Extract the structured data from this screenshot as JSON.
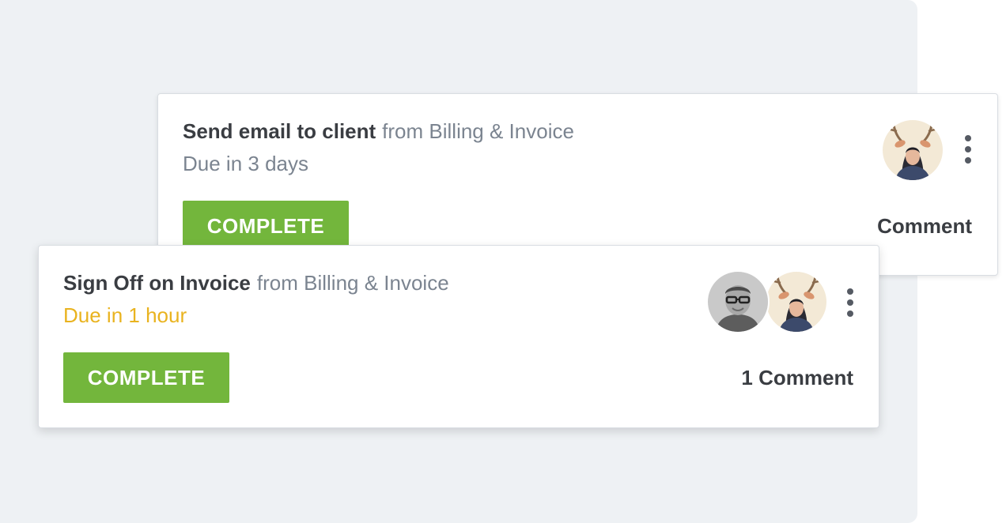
{
  "colors": {
    "backdrop": "#eef1f4",
    "complete_button": "#73b63c",
    "urgent_due": "#e9b31f",
    "muted_text": "#7b8490",
    "title_text": "#3a3d42"
  },
  "tasks": [
    {
      "title": "Send email to client",
      "source": "from Billing & Invoice",
      "due": "Due in 3 days",
      "complete_label": "COMPLETE",
      "comment_label": "Comment",
      "avatars": [
        "woman-with-antlers-avatar"
      ],
      "menu_icon": "kebab-menu-icon"
    },
    {
      "title": "Sign Off on Invoice",
      "source": "from Billing & Invoice",
      "due": "Due in 1 hour",
      "due_urgent": true,
      "complete_label": "COMPLETE",
      "comment_label": "1 Comment",
      "avatars": [
        "man-with-glasses-avatar",
        "woman-with-antlers-avatar"
      ],
      "menu_icon": "kebab-menu-icon"
    }
  ]
}
